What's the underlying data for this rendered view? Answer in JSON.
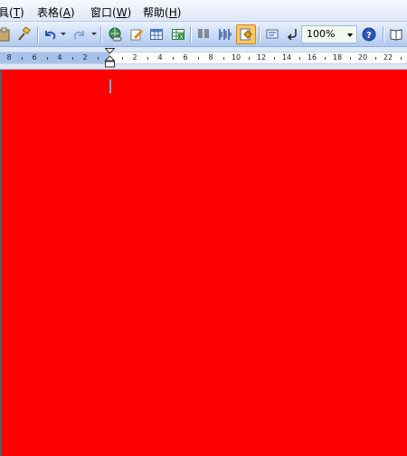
{
  "menubar": {
    "items": [
      {
        "label": "具",
        "acc": "T"
      },
      {
        "label": "表格",
        "acc": "A"
      },
      {
        "label": "窗口",
        "acc": "W"
      },
      {
        "label": "帮助",
        "acc": "H"
      }
    ]
  },
  "toolbar": {
    "zoom_value": "100%",
    "buttons": [
      "paste-icon",
      "format-painter-icon",
      "undo-icon",
      "redo-icon",
      "hyperlink-icon",
      "drawing-icon",
      "insert-table-icon",
      "insert-excel-icon",
      "columns-icon",
      "show-formatting-icon",
      "document-map-icon",
      "read-icon",
      "reading-mode-icon",
      "help-icon",
      "book-icon"
    ]
  },
  "ruler": {
    "left_labels": [
      "8",
      "6",
      "4",
      "2"
    ],
    "right_labels": [
      "2",
      "4",
      "6",
      "8",
      "10",
      "12",
      "14",
      "16",
      "18",
      "20",
      "22"
    ]
  },
  "document": {
    "background": "#ff0000"
  }
}
